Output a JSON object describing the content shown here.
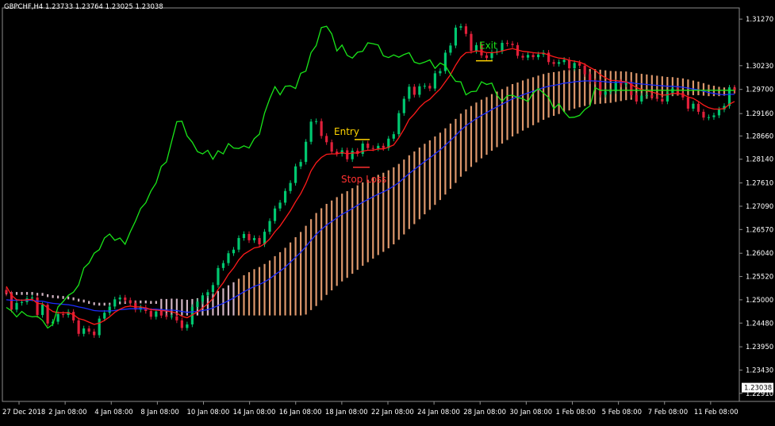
{
  "chart_data": {
    "type": "candlestick",
    "header": "GBPCHF,H4  1.23733 1.23764 1.23025 1.23038",
    "y_axis": {
      "range": [
        1.2273,
        1.3152
      ],
      "ticks": [
        "1.31270",
        "1.30230",
        "1.29700",
        "1.29160",
        "1.28660",
        "1.28140",
        "1.27610",
        "1.27090",
        "1.26570",
        "1.26040",
        "1.25520",
        "1.25000",
        "1.24480",
        "1.23950",
        "1.23430",
        "1.22910"
      ],
      "current_price": "1.23038"
    },
    "x_axis": {
      "ticks": [
        "27 Dec 2018",
        "2 Jan 08:00",
        "4 Jan 08:00",
        "8 Jan 08:00",
        "10 Jan 08:00",
        "14 Jan 08:00",
        "16 Jan 08:00",
        "18 Jan 08:00",
        "22 Jan 08:00",
        "24 Jan 08:00",
        "28 Jan 08:00",
        "30 Jan 08:00",
        "1 Feb 08:00",
        "5 Feb 08:00",
        "7 Feb 08:00",
        "11 Feb 08:00"
      ]
    },
    "annotations": {
      "entry": {
        "label": "Entry",
        "price": 1.2858
      },
      "stop_loss": {
        "label": "Stop Loss",
        "price": 1.2796
      },
      "exit": {
        "label": "Exit",
        "price": 1.3034
      }
    },
    "series_data": {
      "close": [
        1.2514,
        1.2478,
        1.2493,
        1.2495,
        1.2503,
        1.2505,
        1.2466,
        1.2489,
        1.2447,
        1.2451,
        1.2468,
        1.2466,
        1.2473,
        1.2454,
        1.2424,
        1.2436,
        1.2429,
        1.2421,
        1.2458,
        1.2471,
        1.2485,
        1.2501,
        1.2505,
        1.2499,
        1.2493,
        1.2478,
        1.2483,
        1.2475,
        1.2462,
        1.2474,
        1.2465,
        1.2462,
        1.2463,
        1.2454,
        1.2437,
        1.2445,
        1.2484,
        1.2496,
        1.251,
        1.2517,
        1.2533,
        1.2571,
        1.2582,
        1.2604,
        1.2612,
        1.2638,
        1.2647,
        1.2633,
        1.2638,
        1.2624,
        1.2652,
        1.2676,
        1.2704,
        1.2717,
        1.2743,
        1.2761,
        1.2798,
        1.2808,
        1.2853,
        1.2898,
        1.2899,
        1.2866,
        1.2852,
        1.2831,
        1.2826,
        1.2834,
        1.2814,
        1.2833,
        1.2826,
        1.2849,
        1.2839,
        1.2838,
        1.2844,
        1.2839,
        1.286,
        1.287,
        1.2917,
        1.2949,
        1.2976,
        1.2958,
        1.2977,
        1.2978,
        1.2972,
        1.3006,
        1.3011,
        1.3052,
        1.3068,
        1.3108,
        1.3111,
        1.3094,
        1.3056,
        1.3069,
        1.3046,
        1.304,
        1.3053,
        1.3055,
        1.3074,
        1.3072,
        1.3069,
        1.3045,
        1.3041,
        1.3047,
        1.3042,
        1.3048,
        1.3052,
        1.3031,
        1.3027,
        1.3031,
        1.3036,
        1.3017,
        1.3029,
        1.3023,
        1.3004,
        1.2988,
        1.2987,
        1.2958,
        1.2965,
        1.2966,
        1.2987,
        1.2981,
        1.2984,
        1.2957,
        1.2943,
        1.2956,
        1.2957,
        1.2952,
        1.2949,
        1.2943,
        1.2962,
        1.2972,
        1.2962,
        1.2952,
        1.2927,
        1.2938,
        1.292,
        1.2907,
        1.2908,
        1.2912,
        1.2925,
        1.2933,
        1.2974,
        1.2968
      ],
      "ema_fast": [
        1.253,
        1.251,
        1.25,
        1.2499,
        1.25,
        1.2501,
        1.2492,
        1.2491,
        1.2482,
        1.2474,
        1.2471,
        1.2471,
        1.2471,
        1.2467,
        1.2458,
        1.2455,
        1.245,
        1.2445,
        1.2448,
        1.2454,
        1.2462,
        1.2472,
        1.2479,
        1.2484,
        1.2486,
        1.2484,
        1.2484,
        1.2482,
        1.2478,
        1.2477,
        1.2476,
        1.2475,
        1.2473,
        1.247,
        1.2463,
        1.246,
        1.2466,
        1.2473,
        1.2482,
        1.2491,
        1.2503,
        1.2523,
        1.2538,
        1.2557,
        1.2571,
        1.2589,
        1.2602,
        1.2609,
        1.2616,
        1.2618,
        1.2625,
        1.2636,
        1.2652,
        1.2665,
        1.2682,
        1.2699,
        1.2719,
        1.2737,
        1.276,
        1.2788,
        1.2806,
        1.2818,
        1.2825,
        1.2826,
        1.2826,
        1.2829,
        1.2826,
        1.2828,
        1.2828,
        1.2832,
        1.2834,
        1.2834,
        1.2837,
        1.2837,
        1.2841,
        1.2846,
        1.2862,
        1.2881,
        1.2903,
        1.2915,
        1.293,
        1.2941,
        1.2948,
        1.296,
        1.2971,
        1.2987,
        1.3003,
        1.3024,
        1.3042,
        1.3052,
        1.3053,
        1.3056,
        1.3055,
        1.3052,
        1.3052,
        1.3053,
        1.3056,
        1.3059,
        1.3061,
        1.3058,
        1.3055,
        1.3054,
        1.3052,
        1.3051,
        1.3051,
        1.3047,
        1.3043,
        1.304,
        1.3039,
        1.3035,
        1.3033,
        1.3031,
        1.3026,
        1.3019,
        1.3013,
        1.3003,
        1.2996,
        1.299,
        1.299,
        1.2988,
        1.2987,
        1.2981,
        1.2974,
        1.297,
        1.2967,
        1.2964,
        1.2961,
        1.2957,
        1.2958,
        1.2961,
        1.2961,
        1.2959,
        1.2953,
        1.295,
        1.2943,
        1.2935,
        1.2929,
        1.2926,
        1.2926,
        1.2927,
        1.2937,
        1.2943
      ],
      "ema_slow": [
        1.25,
        1.2499,
        1.2499,
        1.2499,
        1.2499,
        1.2499,
        1.2497,
        1.2497,
        1.2494,
        1.2492,
        1.2491,
        1.249,
        1.2489,
        1.2487,
        1.2484,
        1.2482,
        1.2479,
        1.2476,
        1.2475,
        1.2475,
        1.2475,
        1.2476,
        1.2478,
        1.2479,
        1.248,
        1.248,
        1.248,
        1.248,
        1.2479,
        1.2479,
        1.2478,
        1.2477,
        1.2477,
        1.2476,
        1.2474,
        1.2472,
        1.2473,
        1.2474,
        1.2476,
        1.2478,
        1.2482,
        1.2487,
        1.2492,
        1.2498,
        1.2504,
        1.2511,
        1.2518,
        1.2524,
        1.253,
        1.2534,
        1.254,
        1.2547,
        1.2556,
        1.2564,
        1.2573,
        1.2584,
        1.2595,
        1.2606,
        1.2619,
        1.2633,
        1.2646,
        1.2657,
        1.2667,
        1.2675,
        1.2683,
        1.2691,
        1.2697,
        1.2704,
        1.2711,
        1.2718,
        1.2724,
        1.273,
        1.2736,
        1.2741,
        1.2747,
        1.2754,
        1.2762,
        1.2772,
        1.2782,
        1.2791,
        1.28,
        1.2809,
        1.2817,
        1.2826,
        1.2835,
        1.2845,
        1.2856,
        1.2867,
        1.2879,
        1.2889,
        1.2897,
        1.2905,
        1.2912,
        1.2918,
        1.2925,
        1.2931,
        1.2937,
        1.2943,
        1.2949,
        1.2953,
        1.2958,
        1.2962,
        1.2966,
        1.297,
        1.2974,
        1.2977,
        1.2979,
        1.2981,
        1.2984,
        1.2985,
        1.2987,
        1.2988,
        1.2989,
        1.2989,
        1.2989,
        1.2988,
        1.2987,
        1.2986,
        1.2986,
        1.2986,
        1.2986,
        1.2985,
        1.2983,
        1.2982,
        1.2981,
        1.298,
        1.2979,
        1.2978,
        1.2977,
        1.2977,
        1.2976,
        1.2975,
        1.2973,
        1.2971,
        1.2969,
        1.2966,
        1.2963,
        1.2961,
        1.2959,
        1.2958,
        1.2959,
        1.2959
      ]
    }
  }
}
